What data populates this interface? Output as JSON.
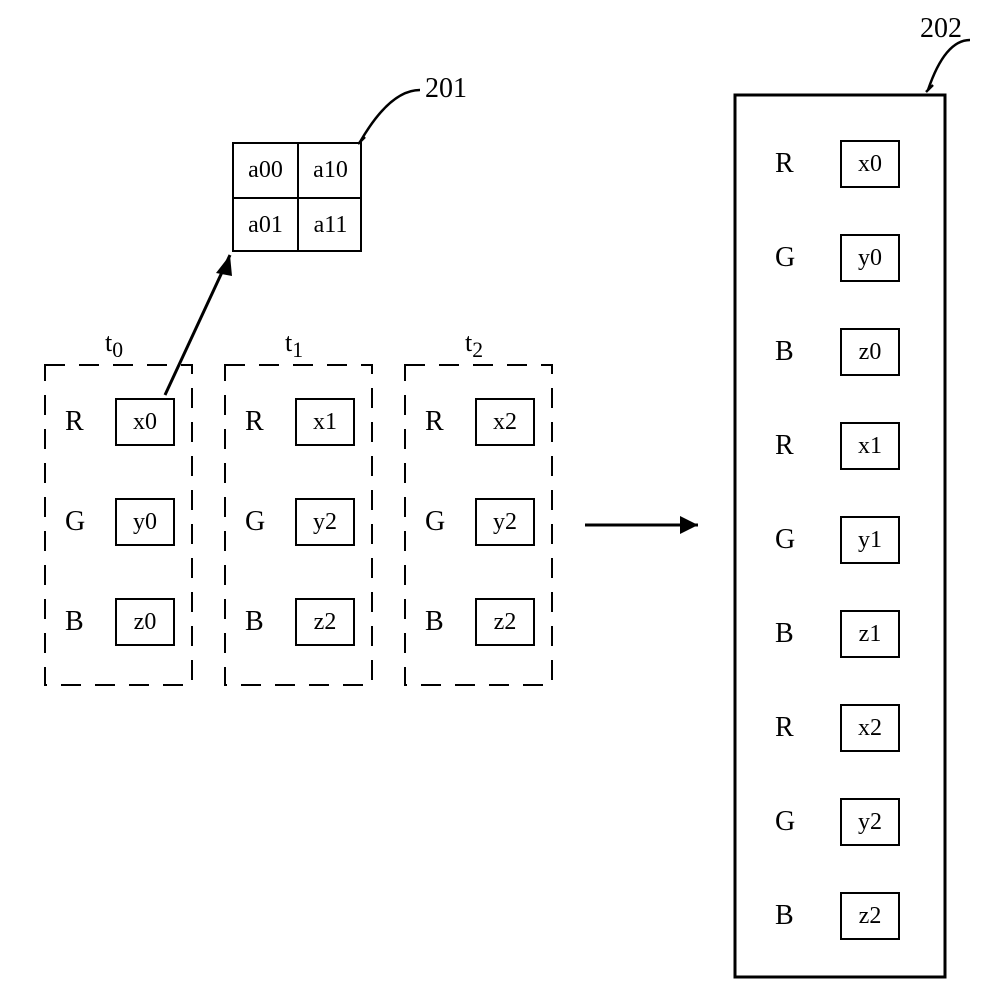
{
  "callouts": {
    "c201": "201",
    "c202": "202"
  },
  "grid201": {
    "a00": "a00",
    "a10": "a10",
    "a01": "a01",
    "a11": "a11"
  },
  "frames": [
    {
      "t": "t",
      "tsub": "0",
      "rows": [
        {
          "ch": "R",
          "val": "x0"
        },
        {
          "ch": "G",
          "val": "y0"
        },
        {
          "ch": "B",
          "val": "z0"
        }
      ]
    },
    {
      "t": "t",
      "tsub": "1",
      "rows": [
        {
          "ch": "R",
          "val": "x1"
        },
        {
          "ch": "G",
          "val": "y2"
        },
        {
          "ch": "B",
          "val": "z2"
        }
      ]
    },
    {
      "t": "t",
      "tsub": "2",
      "rows": [
        {
          "ch": "R",
          "val": "x2"
        },
        {
          "ch": "G",
          "val": "y2"
        },
        {
          "ch": "B",
          "val": "z2"
        }
      ]
    }
  ],
  "stack202": [
    {
      "ch": "R",
      "val": "x0"
    },
    {
      "ch": "G",
      "val": "y0"
    },
    {
      "ch": "B",
      "val": "z0"
    },
    {
      "ch": "R",
      "val": "x1"
    },
    {
      "ch": "G",
      "val": "y1"
    },
    {
      "ch": "B",
      "val": "z1"
    },
    {
      "ch": "R",
      "val": "x2"
    },
    {
      "ch": "G",
      "val": "y2"
    },
    {
      "ch": "B",
      "val": "z2"
    }
  ]
}
